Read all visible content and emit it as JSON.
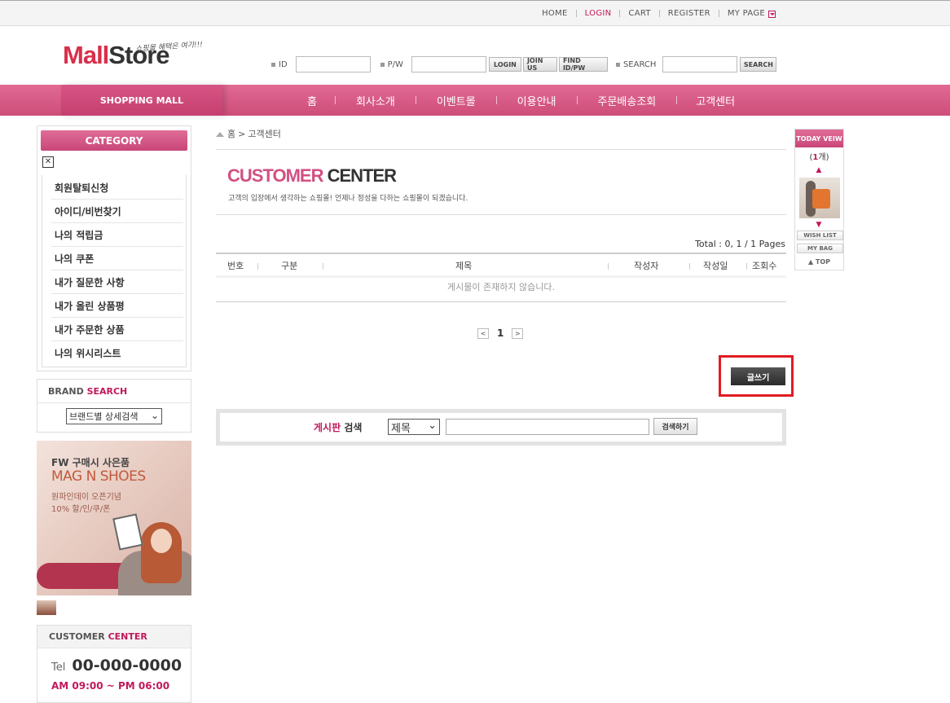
{
  "topnav": [
    "HOME",
    "LOGIN",
    "CART",
    "REGISTER",
    "MY PAGE"
  ],
  "logo": {
    "mall": "Mall",
    "store": "Store",
    "tagline": "쇼핑몰 혜택은 여기!!!"
  },
  "loginbar": {
    "id_label": "ID",
    "pw_label": "P/W",
    "login_button": "LOGIN",
    "join_button": "JOIN US",
    "find_button": "FIND ID/PW",
    "search_label": "SEARCH",
    "search_button": "SEARCH"
  },
  "mainnav": {
    "shopping_mall": "SHOPPING MALL",
    "items": [
      "홈",
      "회사소개",
      "이벤트몰",
      "이용안내",
      "주문배송조회",
      "고객센터"
    ]
  },
  "sidebar": {
    "category_title": "CATEGORY",
    "broken_image": "✕",
    "menu": [
      "회원탈퇴신청",
      "아이디/비번찾기",
      "나의 적립금",
      "나의 쿠폰",
      "내가 질문한 사항",
      "내가 올린 상품평",
      "내가 주문한 상품",
      "나의 위시리스트"
    ],
    "brand_search_prefix": "BRAND",
    "brand_search_suffix": "SEARCH",
    "brand_select": "브랜드별 상세검색",
    "banner": {
      "line1": "FW 구매시 사은품",
      "line2": "MAG N SHOES",
      "line3": "원파인데이 오픈기념\n10% 할/인/쿠/폰"
    },
    "cc_prefix": "CUSTOMER",
    "cc_suffix": "CENTER",
    "tel_label": "Tel",
    "tel_number": "00-000-0000",
    "hours": "AM 09:00 ~ PM 06:00"
  },
  "breadcrumb": {
    "home": "홈",
    "separator": ">",
    "current": "고객센터"
  },
  "page": {
    "title_pink": "CUSTOMER",
    "title_dark": "CENTER",
    "description": "고객의 입장에서 생각하는 쇼핑몰! 언제나 정성을 다하는 쇼핑몰이 되겠습니다.",
    "total": "Total : 0, 1 / 1 Pages"
  },
  "table": {
    "headers": [
      "번호",
      "구분",
      "제목",
      "작성자",
      "작성일",
      "조회수"
    ],
    "empty_message": "게시물이 존재하지 않습니다."
  },
  "pager": {
    "prev": "<",
    "current": "1",
    "next": ">"
  },
  "write_button": "글쓰기",
  "board_search": {
    "label_pink": "게시판",
    "label_dark": "검색",
    "select_value": "제목",
    "button": "검색하기"
  },
  "today_view": {
    "title": "TODAY VEIW",
    "count_open": "(",
    "count_num": "1",
    "count_close": "개)",
    "up": "▲",
    "down": "▼",
    "wish_list": "WISH LIST",
    "my_bag": "MY BAG",
    "top": "▲ TOP"
  },
  "colors": {
    "accent": "#c2185b",
    "nav": "#d75584",
    "highlight": "#e01c22"
  }
}
